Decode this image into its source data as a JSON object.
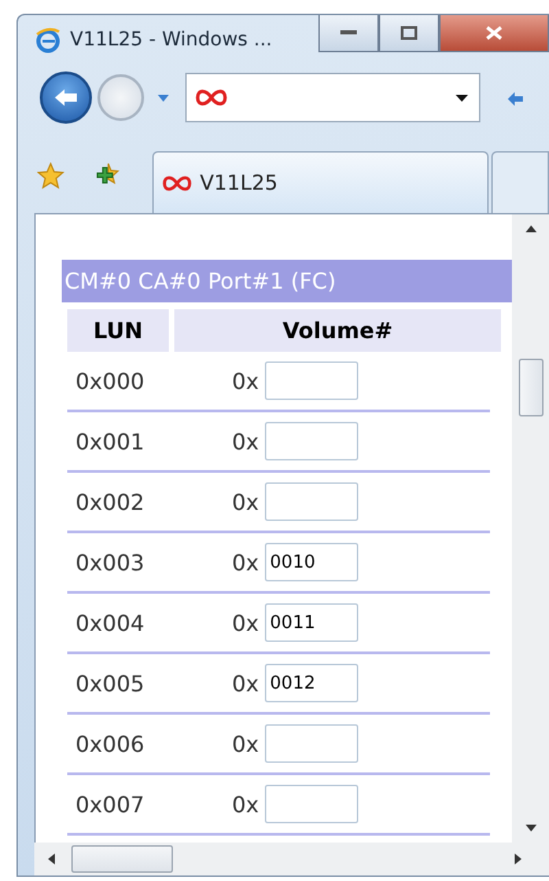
{
  "window": {
    "title": "V11L25 - Windows ..."
  },
  "tab": {
    "label": "V11L25"
  },
  "section": {
    "title": "CM#0 CA#0 Port#1 (FC)"
  },
  "table": {
    "columns": [
      "LUN",
      "Volume#"
    ],
    "rows": [
      {
        "lun": "0x000",
        "prefix": "0x"
      },
      {
        "lun": "0x001",
        "prefix": "0x"
      },
      {
        "lun": "0x002",
        "prefix": "0x"
      },
      {
        "lun": "0x003",
        "prefix": "0x",
        "value": "0010"
      },
      {
        "lun": "0x004",
        "prefix": "0x",
        "value": "0011"
      },
      {
        "lun": "0x005",
        "prefix": "0x",
        "value": "0012"
      },
      {
        "lun": "0x006",
        "prefix": "0x"
      },
      {
        "lun": "0x007",
        "prefix": "0x"
      }
    ]
  }
}
